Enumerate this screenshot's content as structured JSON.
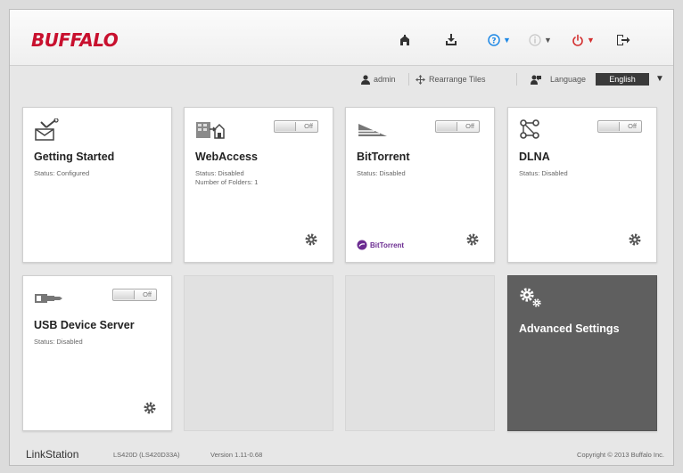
{
  "header": {
    "brand": "BUFFALO",
    "icons": [
      "home-icon",
      "download-icon",
      "help-icon",
      "info-icon",
      "power-icon",
      "logout-icon"
    ],
    "colors": {
      "brand": "#c8102e",
      "help": "#1e88e5",
      "power": "#d32f2f"
    }
  },
  "subbar": {
    "user": "admin",
    "rearrange": "Rearrange Tiles",
    "language_label": "Language",
    "language_value": "English"
  },
  "tiles": [
    {
      "title": "Getting Started",
      "status": "Status: Configured"
    },
    {
      "title": "WebAccess",
      "status": "Status: Disabled",
      "status2": "Number of Folders: 1",
      "toggle": "Off"
    },
    {
      "title": "BitTorrent",
      "status": "Status: Disabled",
      "toggle": "Off",
      "brand": "BitTorrent"
    },
    {
      "title": "DLNA",
      "status": "Status: Disabled",
      "toggle": "Off"
    },
    {
      "title": "USB Device Server",
      "status": "Status: Disabled",
      "toggle": "Off"
    },
    {
      "title": "Advanced Settings"
    }
  ],
  "footer": {
    "product": "LinkStation",
    "model": "LS420D (LS420D33A)",
    "version": "Version 1.11-0.68",
    "copyright": "Copyright © 2013 Buffalo Inc."
  }
}
